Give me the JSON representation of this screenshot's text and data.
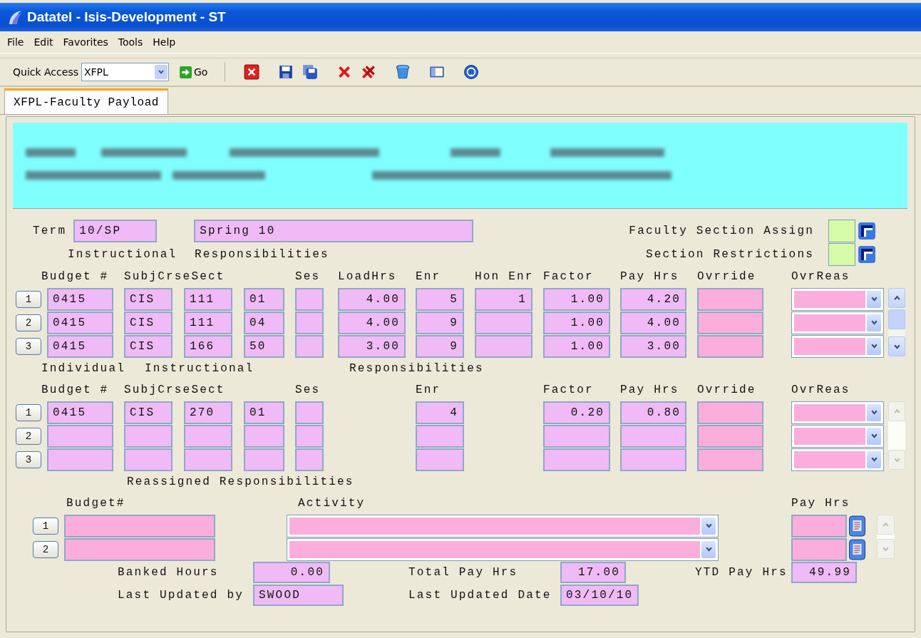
{
  "window": {
    "title": "Datatel - Isis-Development - ST"
  },
  "menu": [
    "File",
    "Edit",
    "Favorites",
    "Tools",
    "Help"
  ],
  "toolbar": {
    "quick_access_label": "Quick Access",
    "quick_access_value": "XFPL",
    "go_label": "Go"
  },
  "tabs": [
    {
      "label": "XFPL-Faculty Payload",
      "selected": true
    }
  ],
  "form": {
    "term": {
      "label": "Term",
      "code": "10/SP",
      "name": "Spring 10"
    },
    "flags": [
      {
        "label": "Faculty Section Assign"
      },
      {
        "label": "Section Restrictions"
      }
    ],
    "sections": [
      {
        "heading": [
          "Instructional",
          "Responsibilities"
        ],
        "scroll_enabled": true,
        "columns": [
          {
            "label": "Budget #",
            "kind": "text"
          },
          {
            "label": "SubjCrseSect",
            "kind": "text"
          },
          {
            "kind": "text"
          },
          {
            "kind": "text"
          },
          {
            "label": "Ses",
            "kind": "text"
          },
          {
            "label": "LoadHrs",
            "kind": "number"
          },
          {
            "label": "Enr",
            "kind": "number"
          },
          {
            "label": "Hon Enr",
            "kind": "number"
          },
          {
            "label": "Factor",
            "kind": "number"
          },
          {
            "label": "Pay Hrs",
            "kind": "number"
          },
          {
            "label": "Ovrride",
            "kind": "override"
          },
          {
            "label": "OvrReas",
            "kind": "dropdown"
          }
        ],
        "rows": [
          {
            "number": "1",
            "cells": [
              "0415",
              "CIS",
              "111",
              "01",
              null,
              "4.00",
              "5",
              "1",
              "1.00",
              "4.20",
              null,
              null
            ]
          },
          {
            "number": "2",
            "cells": [
              "0415",
              "CIS",
              "111",
              "04",
              null,
              "4.00",
              "9",
              null,
              "1.00",
              "4.00",
              null,
              null
            ]
          },
          {
            "number": "3",
            "cells": [
              "0415",
              "CIS",
              "166",
              "50",
              null,
              "3.00",
              "9",
              null,
              "1.00",
              "3.00",
              null,
              null
            ]
          }
        ]
      },
      {
        "heading": [
          "Individual",
          "Instructional",
          "Responsibilities"
        ],
        "scroll_enabled": false,
        "columns": [
          {
            "label": "Budget #",
            "kind": "text"
          },
          {
            "label": "SubjCrseSect",
            "kind": "text"
          },
          {
            "kind": "text"
          },
          {
            "kind": "text"
          },
          {
            "label": "Ses",
            "kind": "text"
          },
          {
            "label": "Enr",
            "kind": "number"
          },
          {
            "label": "Factor",
            "kind": "number"
          },
          {
            "label": "Pay Hrs",
            "kind": "number"
          },
          {
            "label": "Ovrride",
            "kind": "override"
          },
          {
            "label": "OvrReas",
            "kind": "dropdown"
          }
        ],
        "rows": [
          {
            "number": "1",
            "cells": [
              "0415",
              "CIS",
              "270",
              "01",
              null,
              "4",
              "0.20",
              "0.80",
              null,
              null
            ]
          },
          {
            "number": "2"
          },
          {
            "number": "3"
          }
        ]
      }
    ],
    "reassigned": {
      "heading": "Reassigned Responsibilities",
      "scroll_enabled": false,
      "budget_label": "Budget#",
      "activity_label": "Activity",
      "pay_label": "Pay Hrs",
      "rows": [
        {
          "number": "1"
        },
        {
          "number": "2"
        }
      ]
    },
    "summary": [
      [
        {
          "label": "Banked Hours",
          "value": "0.00",
          "kind": "number"
        },
        {
          "label": "Total Pay Hrs",
          "value": "17.00",
          "kind": "number"
        },
        {
          "label": "YTD Pay Hrs",
          "value": "49.99",
          "kind": "number"
        }
      ],
      [
        {
          "label": "Last Updated by",
          "value": "SWOOD",
          "kind": "text"
        },
        {
          "label": "Last Updated Date",
          "value": "03/10/10",
          "kind": "text"
        }
      ]
    ]
  }
}
